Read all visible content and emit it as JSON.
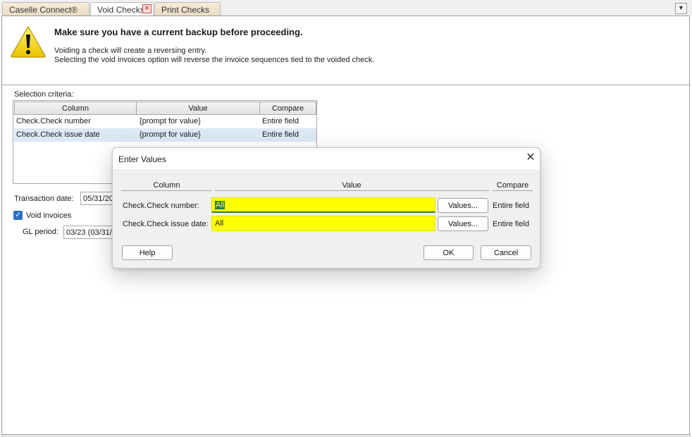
{
  "tabs": [
    {
      "label": "Caselle Connect®"
    },
    {
      "label": "Void Checks",
      "close": "×"
    },
    {
      "label": "Print Checks"
    }
  ],
  "tab_menu_glyph": "▼",
  "warning": {
    "icon": "warning-triangle-icon",
    "title": "Make sure you have a current backup before proceeding.",
    "line1": "Voiding a check will create a reversing entry.",
    "line2": "Selecting the void invoices option will reverse the invoice sequences tied to the voided check."
  },
  "selection": {
    "label": "Selection criteria:",
    "columns": [
      "Column",
      "Value",
      "Compare"
    ],
    "rows": [
      {
        "column": "Check.Check number",
        "value": "{prompt for value}",
        "compare": "Entire field"
      },
      {
        "column": "Check.Check issue date",
        "value": "{prompt for value}",
        "compare": "Entire field"
      }
    ]
  },
  "form": {
    "transaction_date_label": "Transaction date:",
    "transaction_date_value": "05/31/20",
    "void_invoices_label": "Void invoices",
    "void_invoices_checked": true,
    "gl_period_label": "GL period:",
    "gl_period_value": "03/23 (03/31/"
  },
  "dialog": {
    "title": "Enter Values",
    "close": "✕",
    "columns": [
      "Column",
      "Value",
      "Compare"
    ],
    "rows": [
      {
        "label": "Check.Check number:",
        "value": "All",
        "values_button": "Values...",
        "compare": "Entire field"
      },
      {
        "label": "Check.Check issue date:",
        "value": "All",
        "values_button": "Values...",
        "compare": "Entire field"
      }
    ],
    "help_button": "Help",
    "ok_button": "OK",
    "cancel_button": "Cancel"
  },
  "colors": {
    "highlight": "#ffff00",
    "selection": "#2e7d32",
    "row_selected": "#dde8f6",
    "checkbox": "#2b6fc6"
  }
}
